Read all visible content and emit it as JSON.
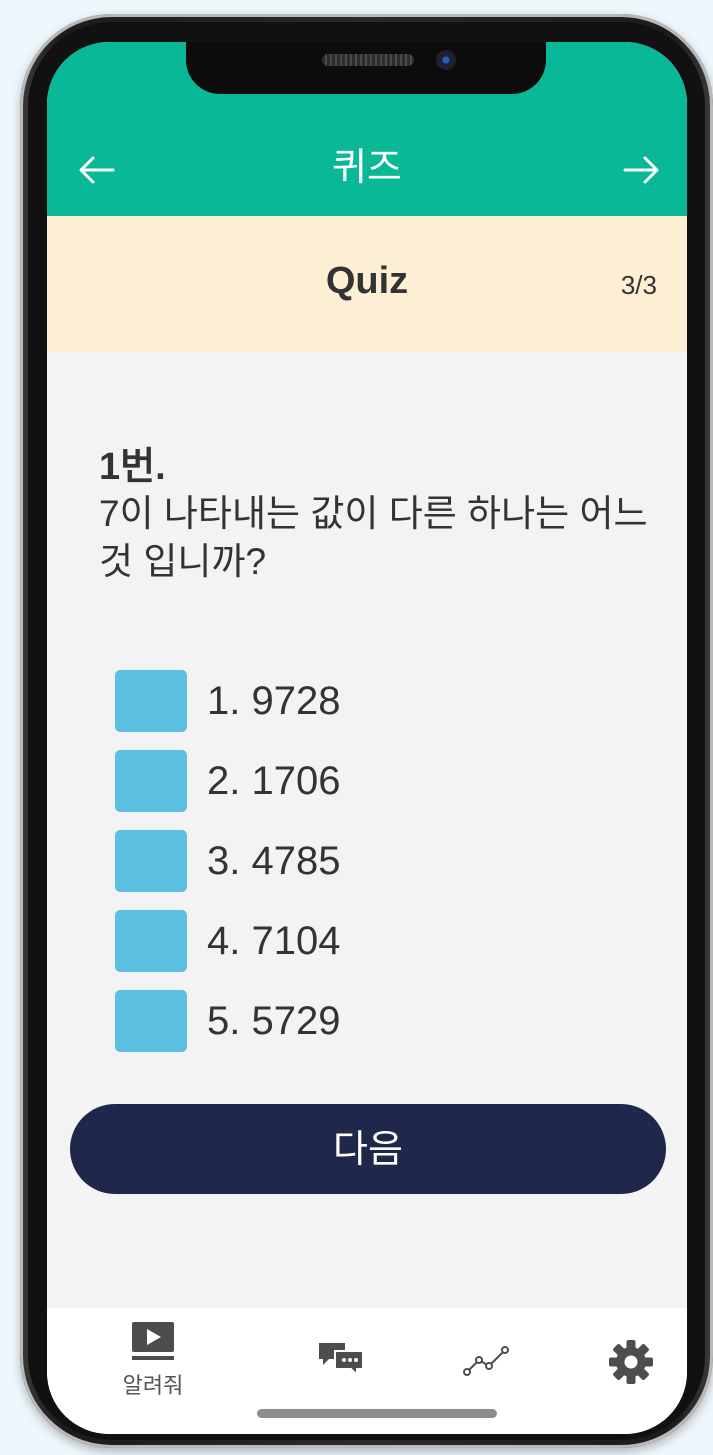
{
  "header": {
    "title": "퀴즈",
    "back_icon": "arrow-left-icon",
    "forward_icon": "arrow-right-icon",
    "color": "#09b897"
  },
  "quiz_banner": {
    "title": "Quiz",
    "progress": "3/3",
    "color": "#fdefd4"
  },
  "question": {
    "number": "1번.",
    "text": "7이 나타내는 값이 다른 하나는 어느것 입니까?"
  },
  "options": [
    {
      "label": "1. 9728"
    },
    {
      "label": "2. 1706"
    },
    {
      "label": "3. 4785"
    },
    {
      "label": "4. 7104"
    },
    {
      "label": "5. 5729"
    }
  ],
  "option_box_color": "#5bbfdf",
  "next_button": {
    "label": "다음",
    "color": "#1f274a"
  },
  "tab_bar": {
    "tabs": [
      {
        "icon": "video-play-icon",
        "label": "알려줘"
      },
      {
        "icon": "chat-bubbles-icon",
        "label": ""
      },
      {
        "icon": "line-chart-icon",
        "label": ""
      },
      {
        "icon": "gear-icon",
        "label": ""
      }
    ]
  }
}
